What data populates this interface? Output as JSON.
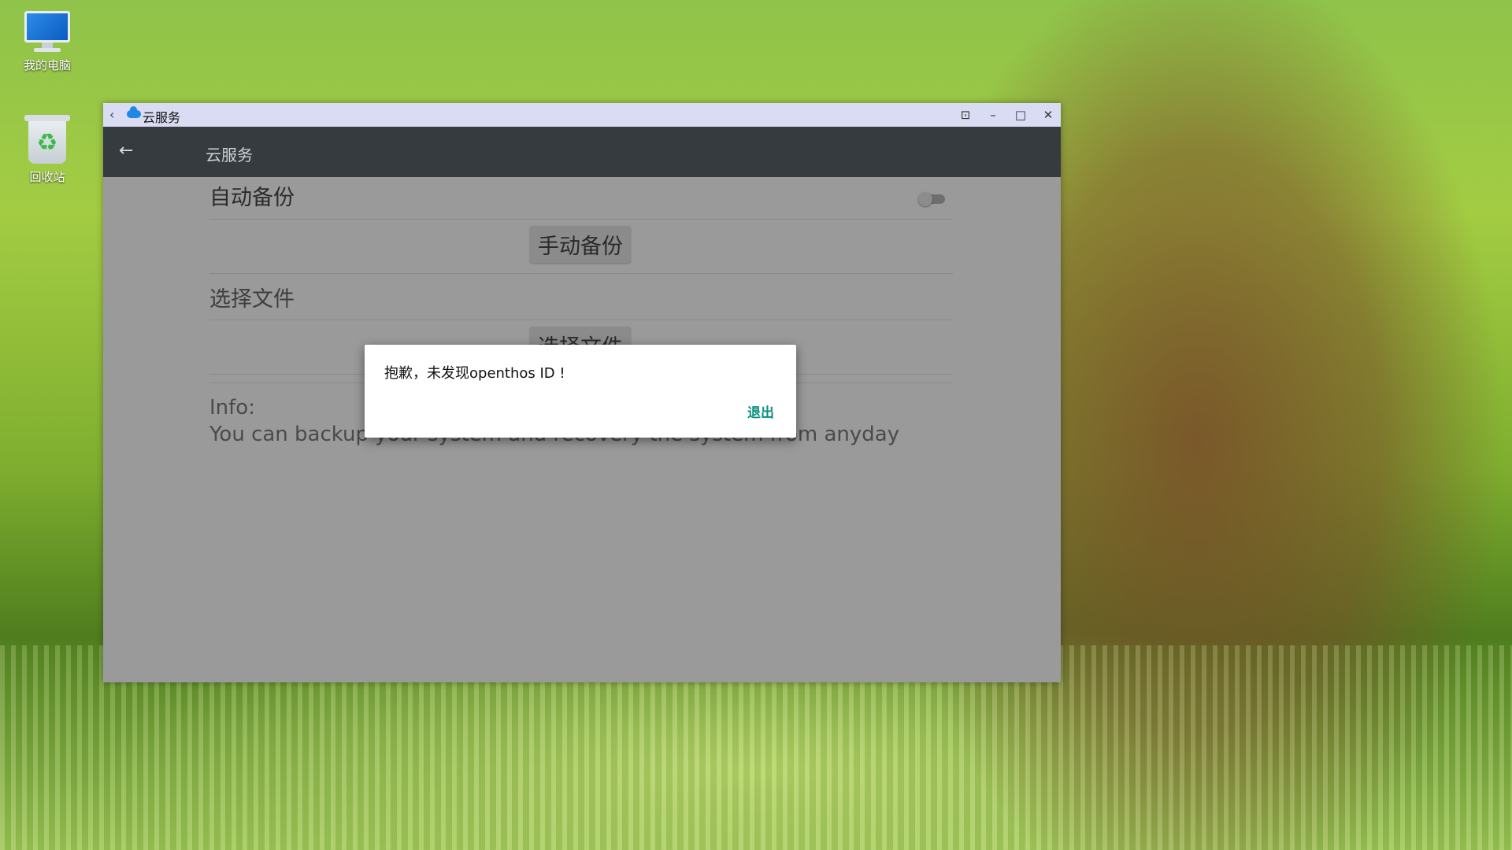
{
  "desktop": {
    "icons": [
      {
        "label": "我的电脑",
        "icon": "computer-icon"
      },
      {
        "label": "回收站",
        "icon": "recycle-bin-icon"
      }
    ]
  },
  "window": {
    "title": "云服务",
    "controls": {
      "pin": "pin-icon",
      "minimize": "minimize-icon",
      "maximize": "maximize-icon",
      "close": "close-icon"
    }
  },
  "appbar": {
    "title": "云服务"
  },
  "settings": {
    "auto_backup_label": "自动备份",
    "auto_backup_enabled": false,
    "manual_backup_button": "手动备份",
    "select_file_label": "选择文件",
    "select_file_button": "选择文件",
    "info_title": "Info:",
    "info_text": "You can backup your system and recovery the system from anyday"
  },
  "dialog": {
    "message": "抱歉，未发现openthos ID !",
    "exit_button": "退出"
  }
}
